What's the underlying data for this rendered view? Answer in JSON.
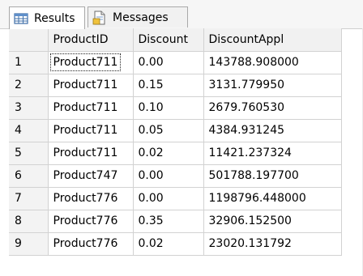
{
  "tabs": [
    {
      "label": "Results",
      "icon": "grid-icon",
      "active": true
    },
    {
      "label": "Messages",
      "icon": "messages-icon",
      "active": false
    }
  ],
  "grid": {
    "columns": [
      "ProductID",
      "Discount",
      "DiscountAppl"
    ],
    "rows": [
      {
        "num": "1",
        "cells": [
          "Product711",
          "0.00",
          "143788.908000"
        ]
      },
      {
        "num": "2",
        "cells": [
          "Product711",
          "0.15",
          "3131.779950"
        ]
      },
      {
        "num": "3",
        "cells": [
          "Product711",
          "0.10",
          "2679.760530"
        ]
      },
      {
        "num": "4",
        "cells": [
          "Product711",
          "0.05",
          "4384.931245"
        ]
      },
      {
        "num": "5",
        "cells": [
          "Product711",
          "0.02",
          "11421.237324"
        ]
      },
      {
        "num": "6",
        "cells": [
          "Product747",
          "0.00",
          "501788.197700"
        ]
      },
      {
        "num": "7",
        "cells": [
          "Product776",
          "0.00",
          "1198796.448000"
        ]
      },
      {
        "num": "8",
        "cells": [
          "Product776",
          "0.35",
          "32906.152500"
        ]
      },
      {
        "num": "9",
        "cells": [
          "Product776",
          "0.02",
          "23020.131792"
        ]
      }
    ]
  },
  "colors": {
    "header_bg": "#f1f1f1",
    "gridline": "#d2d2d2",
    "tab_border": "#a9a9a9"
  }
}
